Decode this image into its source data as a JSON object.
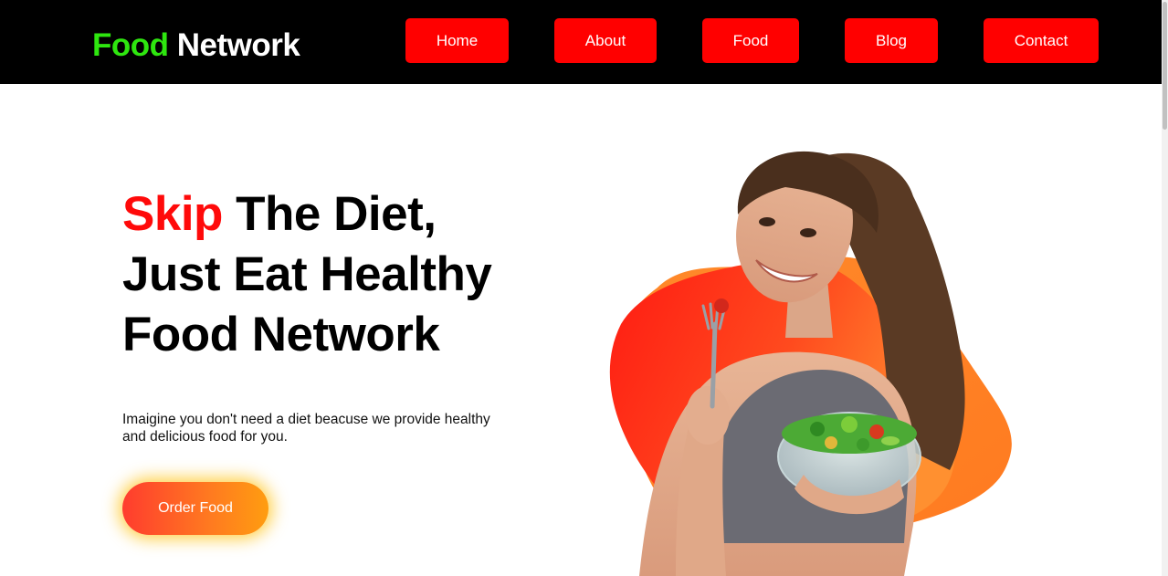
{
  "brand": {
    "part1": "Food",
    "part2": "Network"
  },
  "nav": {
    "home": "Home",
    "about": "About",
    "food": "Food",
    "blog": "Blog",
    "contact": "Contact"
  },
  "hero": {
    "headline_highlight": "Skip",
    "headline_line1_rest": " The Diet,",
    "headline_line2": "Just Eat Healthy",
    "headline_line3": "Food Network",
    "description": "Imaigine you don't need a diet beacuse we provide healthy and delicious food for you.",
    "cta_label": "Order Food"
  },
  "colors": {
    "navbar_bg": "#000000",
    "brand_green": "#2ee60f",
    "nav_button_red": "#ff0000",
    "headline_red": "#ff0a0a",
    "cta_gradient_start": "#ff3c2e",
    "cta_gradient_end": "#ff9d10",
    "blob_orange": "#ff8a2a",
    "blob_red": "#ff1a12"
  },
  "icons": {
    "hero_image": "woman-eating-salad-illustration",
    "hero_blob": "orange-red-gradient-blob"
  }
}
